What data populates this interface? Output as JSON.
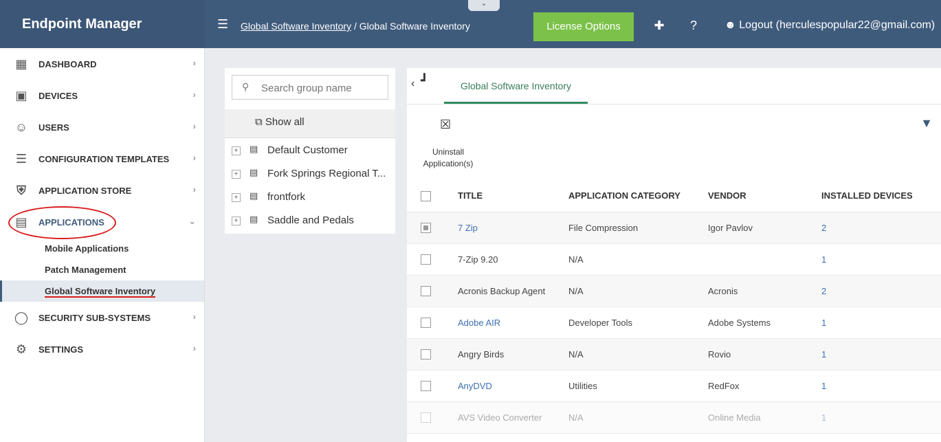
{
  "app": {
    "brand": "Endpoint Manager",
    "collapse_glyph": "⌄"
  },
  "header": {
    "breadcrumb_link": "Global Software Inventory",
    "breadcrumb_sep": " / ",
    "breadcrumb_current": "Global Software Inventory",
    "license_button": "License Options",
    "logout": "Logout (herculespopular22@gmail.com)"
  },
  "sidebar": {
    "items": [
      {
        "label": "DASHBOARD",
        "icon": "dashboard-icon"
      },
      {
        "label": "DEVICES",
        "icon": "devices-icon"
      },
      {
        "label": "USERS",
        "icon": "users-icon"
      },
      {
        "label": "CONFIGURATION TEMPLATES",
        "icon": "templates-icon"
      },
      {
        "label": "APPLICATION STORE",
        "icon": "store-icon"
      },
      {
        "label": "APPLICATIONS",
        "icon": "applications-icon"
      },
      {
        "label": "SECURITY SUB-SYSTEMS",
        "icon": "shield-icon"
      },
      {
        "label": "SETTINGS",
        "icon": "gear-icon"
      }
    ],
    "subitems": [
      "Mobile Applications",
      "Patch Management",
      "Global Software Inventory"
    ]
  },
  "groups": {
    "search_placeholder": "Search group name",
    "show_all": "Show all",
    "list": [
      "Default Customer",
      "Fork Springs Regional T...",
      "frontfork",
      "Saddle and Pedals"
    ]
  },
  "main": {
    "tab": "Global Software Inventory",
    "uninstall_line1": "Uninstall",
    "uninstall_line2": "Application(s)",
    "columns": [
      "TITLE",
      "APPLICATION CATEGORY",
      "VENDOR",
      "INSTALLED DEVICES"
    ],
    "rows": [
      {
        "title": "7 Zip",
        "category": "File Compression",
        "vendor": "Igor Pavlov",
        "devices": "2"
      },
      {
        "title": "7-Zip 9.20",
        "category": "N/A",
        "vendor": "",
        "devices": "1"
      },
      {
        "title": "Acronis Backup Agent",
        "category": "N/A",
        "vendor": "Acronis",
        "devices": "2"
      },
      {
        "title": "Adobe AIR",
        "category": "Developer Tools",
        "vendor": "Adobe Systems",
        "devices": "1"
      },
      {
        "title": "Angry Birds",
        "category": "N/A",
        "vendor": "Rovio",
        "devices": "1"
      },
      {
        "title": "AnyDVD",
        "category": "Utilities",
        "vendor": "RedFox",
        "devices": "1"
      },
      {
        "title": "AVS Video Converter",
        "category": "N/A",
        "vendor": "Online Media",
        "devices": "1"
      }
    ]
  },
  "colors": {
    "topbar": "#3f5b7c",
    "accent_green": "#7cc24a",
    "tab_green": "#2f8a63",
    "link_blue": "#3d6fb0",
    "highlight_red": "#d81c1c"
  }
}
